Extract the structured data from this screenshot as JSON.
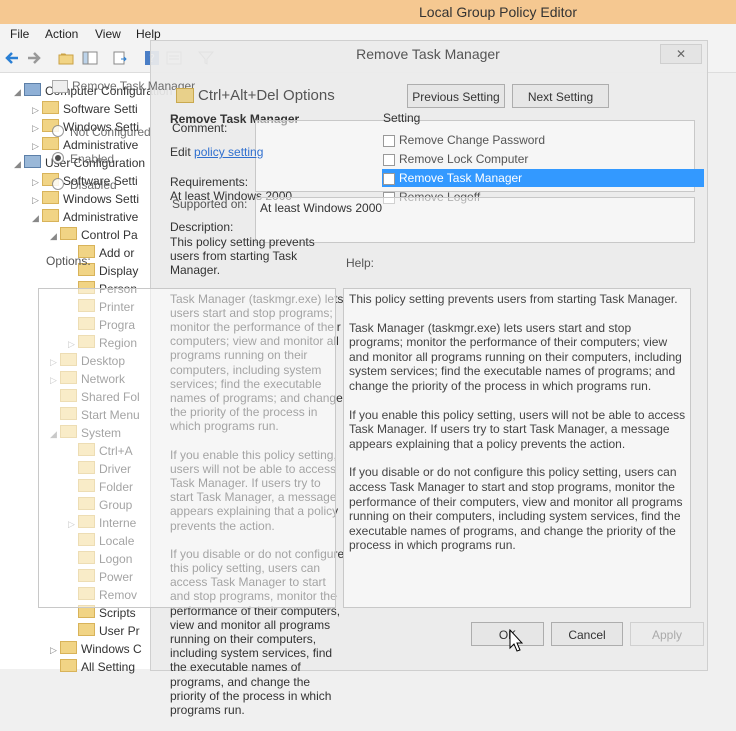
{
  "window": {
    "title": "Local Group Policy Editor"
  },
  "menu": [
    "File",
    "Action",
    "View",
    "Help"
  ],
  "tree": [
    {
      "label": "Computer Configuration",
      "indent": 0,
      "tw": "◢",
      "icon": "computer"
    },
    {
      "label": "Software Setti",
      "indent": 1,
      "tw": "▷",
      "icon": "folder"
    },
    {
      "label": "Windows Setti",
      "indent": 1,
      "tw": "▷",
      "icon": "folder"
    },
    {
      "label": "Administrative",
      "indent": 1,
      "tw": "▷",
      "icon": "folder"
    },
    {
      "label": "User Configuration",
      "indent": 0,
      "tw": "◢",
      "icon": "user"
    },
    {
      "label": "Software Setti",
      "indent": 1,
      "tw": "▷",
      "icon": "folder"
    },
    {
      "label": "Windows Setti",
      "indent": 1,
      "tw": "▷",
      "icon": "folder"
    },
    {
      "label": "Administrative",
      "indent": 1,
      "tw": "◢",
      "icon": "folder"
    },
    {
      "label": "Control Pa",
      "indent": 2,
      "tw": "◢",
      "icon": "folder"
    },
    {
      "label": "Add or",
      "indent": 3,
      "tw": "",
      "icon": "folder"
    },
    {
      "label": "Display",
      "indent": 3,
      "tw": "",
      "icon": "folder"
    },
    {
      "label": "Person",
      "indent": 3,
      "tw": "",
      "icon": "folder"
    },
    {
      "label": "Printer",
      "indent": 3,
      "tw": "",
      "icon": "folder"
    },
    {
      "label": "Progra",
      "indent": 3,
      "tw": "",
      "icon": "folder"
    },
    {
      "label": "Region",
      "indent": 3,
      "tw": "▷",
      "icon": "folder"
    },
    {
      "label": "Desktop",
      "indent": 2,
      "tw": "▷",
      "icon": "folder"
    },
    {
      "label": "Network",
      "indent": 2,
      "tw": "▷",
      "icon": "folder"
    },
    {
      "label": "Shared Fol",
      "indent": 2,
      "tw": "",
      "icon": "folder"
    },
    {
      "label": "Start Menu",
      "indent": 2,
      "tw": "",
      "icon": "folder"
    },
    {
      "label": "System",
      "indent": 2,
      "tw": "◢",
      "icon": "folder"
    },
    {
      "label": "Ctrl+A",
      "indent": 3,
      "tw": "",
      "icon": "folder"
    },
    {
      "label": "Driver",
      "indent": 3,
      "tw": "",
      "icon": "folder"
    },
    {
      "label": "Folder",
      "indent": 3,
      "tw": "",
      "icon": "folder"
    },
    {
      "label": "Group",
      "indent": 3,
      "tw": "",
      "icon": "folder"
    },
    {
      "label": "Interne",
      "indent": 3,
      "tw": "▷",
      "icon": "folder"
    },
    {
      "label": "Locale",
      "indent": 3,
      "tw": "",
      "icon": "folder"
    },
    {
      "label": "Logon",
      "indent": 3,
      "tw": "",
      "icon": "folder"
    },
    {
      "label": "Power",
      "indent": 3,
      "tw": "",
      "icon": "folder"
    },
    {
      "label": "Remov",
      "indent": 3,
      "tw": "",
      "icon": "folder"
    },
    {
      "label": "Scripts",
      "indent": 3,
      "tw": "",
      "icon": "folder"
    },
    {
      "label": "User Pr",
      "indent": 3,
      "tw": "",
      "icon": "folder"
    },
    {
      "label": "Windows C",
      "indent": 2,
      "tw": "▷",
      "icon": "folder"
    },
    {
      "label": "All Setting",
      "indent": 2,
      "tw": "",
      "icon": "folder"
    }
  ],
  "dialog": {
    "title": "Remove Task Manager",
    "close": "✕",
    "tab_label": "Remove Task Manager",
    "prev_btn": "Previous Setting",
    "next_btn": "Next Setting",
    "radio_not_configured": "Not Configured",
    "radio_enabled": "Enabled",
    "radio_disabled": "Disabled",
    "comment_label": "Comment:",
    "supported_label": "Supported on:",
    "supported_value": "At least Windows 2000",
    "options_label": "Options:",
    "help_label": "Help:",
    "ok": "OK",
    "cancel": "Cancel",
    "apply": "Apply",
    "help_text": [
      "This policy setting prevents users from starting Task Manager.",
      "Task Manager (taskmgr.exe) lets users start and stop programs; monitor the performance of their computers; view and monitor all programs running on their computers, including system services; find the executable names of programs; and change the priority of the process in which programs run.",
      "If you enable this policy setting, users will not be able to access Task Manager. If users try to start Task Manager, a message appears explaining that a policy prevents the action.",
      "If you disable or do not configure this policy setting, users can access Task Manager to  start and stop programs, monitor the performance of their computers, view and monitor all programs running on their computers, including system services, find the executable names of programs, and change the priority of the process in which programs run."
    ]
  },
  "background_panel": {
    "header": "Ctrl+Alt+Del Options",
    "setting_title": "Remove Task Manager",
    "edit_prefix": "Edit ",
    "edit_link": "policy setting",
    "requirements_label": "Requirements:",
    "requirements_value": "At least Windows 2000",
    "description_label": "Description:",
    "description": [
      "This policy setting prevents users from starting Task Manager.",
      "Task Manager (taskmgr.exe) lets users start and stop programs; monitor the performance of their computers; view and monitor all programs running on their computers, including system services; find the executable names of programs; and change the priority of the process in which programs run.",
      "If you enable this policy setting, users will not be able to access Task Manager. If users try to start Task Manager, a message appears explaining that a policy prevents the action.",
      "If you disable or do not configure this policy setting, users can access Task Manager to  start and stop programs, monitor the performance of their computers, view and monitor all programs running on their computers, including system services, find the executable names of programs, and change the priority of the process in which programs run."
    ],
    "setting_col": "Setting",
    "settings": [
      {
        "label": "Remove Change Password",
        "selected": false
      },
      {
        "label": "Remove Lock Computer",
        "selected": false
      },
      {
        "label": "Remove Task Manager",
        "selected": true
      },
      {
        "label": "Remove Logoff",
        "selected": false
      }
    ]
  },
  "colors": {
    "titlebar": "#f5c891",
    "selection": "#3399ff",
    "link": "#2f6fcf"
  }
}
